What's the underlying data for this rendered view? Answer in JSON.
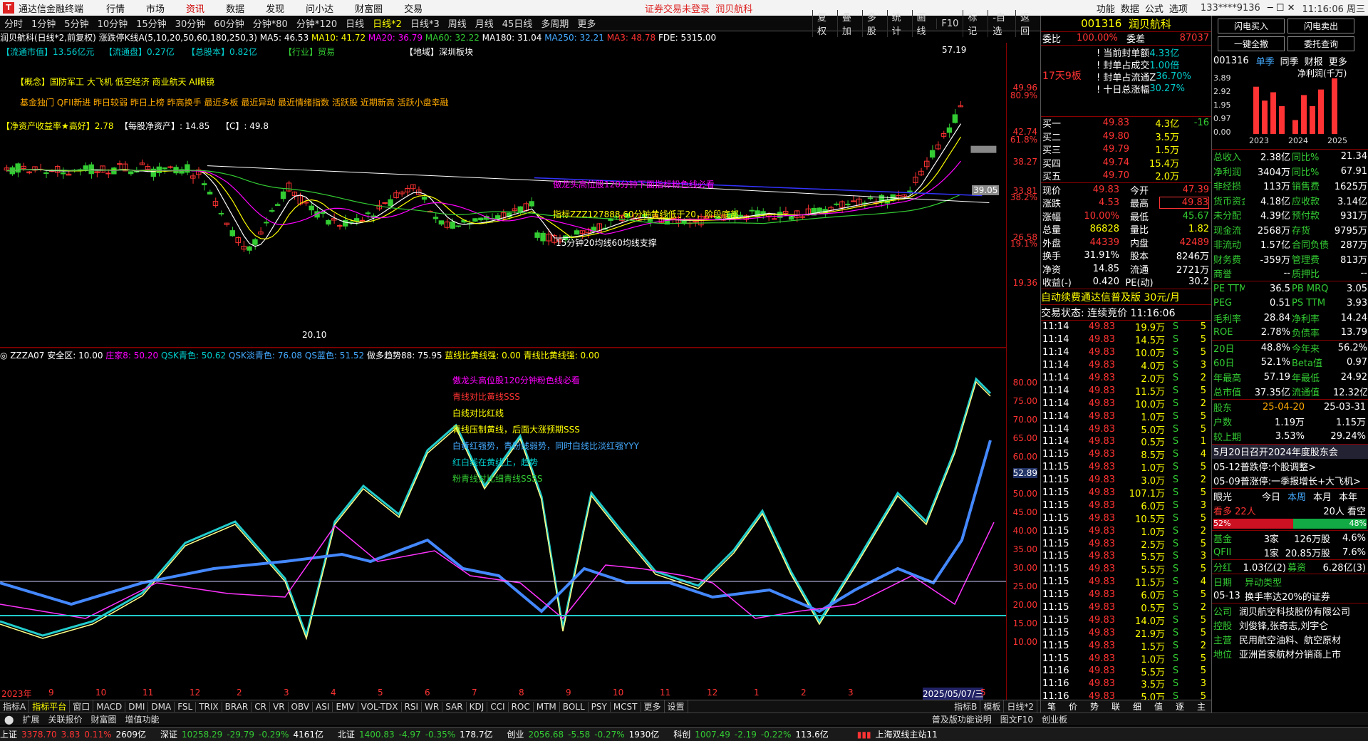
{
  "app": {
    "title": "通达信金融终端",
    "menu": [
      "行情",
      "市场",
      "资讯",
      "数据",
      "发现",
      "问小达",
      "财富圈",
      "交易"
    ],
    "menu_active": "资讯",
    "notice": "证券交易未登录",
    "notice2": "润贝航科",
    "right_menu": [
      "功能",
      "数据",
      "公式",
      "选项"
    ],
    "account": "133****9136",
    "clock": "11:16:06 周三"
  },
  "periods": [
    "分时",
    "1分钟",
    "5分钟",
    "10分钟",
    "15分钟",
    "30分钟",
    "60分钟",
    "分钟*80",
    "分钟*120",
    "日线",
    "日线*2",
    "日线*3",
    "周线",
    "月线",
    "45日线",
    "多周期",
    "更多"
  ],
  "period_active": "日线*2",
  "toolbar2": [
    "复权",
    "叠加",
    "多股",
    "统计",
    "画线",
    "F10",
    "标记",
    "-自选",
    "返回"
  ],
  "infoline": {
    "name": "润贝航科(日线*2,前复权)",
    "ind": "涨跌停K线A(5,10,20,50,60,180,250,3)",
    "ma5": "MA5: 46.53",
    "ma10": "MA10: 41.72",
    "ma20": "MA20: 36.79",
    "ma60": "MA60: 32.22",
    "ma180": "MA180: 31.04",
    "ma250": "MA250: 32.21",
    "ma3": "MA3: 48.78",
    "fde": "FDE: 5315.00"
  },
  "tags": {
    "ltsz": "【流通市值】13.56亿元",
    "ltp": "【流通盘】0.27亿",
    "zgb": "【总股本】0.82亿",
    "hy": "【行业】贸易",
    "dy": "【地域】深圳板块",
    "gn": "【概念】国防军工 大飞机 低空经济 商业航天 AI眼镜",
    "fg": "基金独门 QFII新进 昨日较弱 昨日上榜 昨高换手 最近多板 最近异动 最近情绪指数 活跃股 近期新高 活跃小盘幸融",
    "roe": "【净资产收益率★高好】2.78",
    "mgjzc": "【每股净资产】: 14.85",
    "c": "【C】: 49.8",
    "ann1": "傲龙头高位股120分钟下面指标粉色线必看",
    "ann2": "指标ZZZ127888,60分钟黄线低于20，阶段底部",
    "ann3": "15分钟20均线60均线支撑",
    "high": "57.19",
    "low": "20.10",
    "cur_tag": "39.05"
  },
  "axis1": [
    "49.96",
    "80.9%",
    "42.74",
    "61.8%",
    "38.27",
    "33.81",
    "38.2%",
    "26.58",
    "19.1%",
    "19.36"
  ],
  "ind": {
    "head": "ZZZA07",
    "items": [
      "安全区: 10.00",
      "庄家8: 50.20",
      "QSK青色: 50.62",
      "QSK淡青色: 76.08",
      "QS蓝色: 51.52",
      "做多趋势88: 75.95",
      "蓝线比黄线强: 0.00",
      "青线比黄线强: 0.00"
    ],
    "text": [
      "傲龙头高位股120分钟粉色线必看",
      "青线对比黄线SSS",
      "白线对比红线",
      "青线压制黄线，后面大涨预期SSS",
      "白黄红强势，青粉线弱势，同时白线比淡红强YYY",
      "红白线在黄线上，趋势",
      "粉青线对比细青线SSSS"
    ],
    "axis": [
      "80.00",
      "75.00",
      "70.00",
      "65.00",
      "60.00",
      "55.00",
      "52.89",
      "50.00",
      "45.00",
      "40.00",
      "35.00",
      "30.00",
      "25.00",
      "20.00",
      "15.00",
      "10.00"
    ]
  },
  "dates": [
    "2023年",
    "9",
    "10",
    "11",
    "12",
    "2",
    "3",
    "4",
    "5",
    "6",
    "7",
    "8",
    "9",
    "10",
    "11",
    "12",
    "1",
    "2",
    "3",
    "2025/05/07/三",
    "5"
  ],
  "bottomtabs": [
    "指标A",
    "指标平台",
    "窗口",
    "MACD",
    "DMI",
    "DMA",
    "FSL",
    "TRIX",
    "BRAR",
    "CR",
    "VR",
    "OBV",
    "ASI",
    "EMV",
    "VOL-TDX",
    "RSI",
    "WR",
    "SAR",
    "KDJ",
    "CCI",
    "ROC",
    "MTM",
    "BOLL",
    "PSY",
    "MCST",
    "更多",
    "设置"
  ],
  "bottomtabs_right": [
    "指标B",
    "模板",
    "日线*2"
  ],
  "bottomtabs2": [
    "扩展",
    "关联报价",
    "财富圈",
    "增值功能"
  ],
  "bottomtabs2_right": [
    "普及版功能说明",
    "图文F10",
    "创业板"
  ],
  "status": {
    "sh": "上证",
    "sh_v": "3378.70",
    "sh_c": "3.83",
    "sh_p": "0.11%",
    "sh_a": "2609亿",
    "sz": "深证",
    "sz_v": "10258.29",
    "sz_c": "-29.79",
    "sz_p": "-0.29%",
    "sz_a": "4161亿",
    "bz": "北证",
    "bz_v": "1400.83",
    "bz_c": "-4.97",
    "bz_p": "-0.35%",
    "bz_a": "178.7亿",
    "cy": "创业",
    "cy_v": "2056.68",
    "cy_c": "-5.58",
    "cy_p": "-0.27%",
    "cy_a": "1930亿",
    "kc": "科创",
    "kc_v": "1007.49",
    "kc_c": "-2.19",
    "kc_p": "-0.22%",
    "kc_a": "113.6亿",
    "server": "上海双线主站11"
  },
  "quote": {
    "code": "001316",
    "name": "润贝航科",
    "wb_label": "委比",
    "wb": "100.00%",
    "wc_label": "委差",
    "wc": "87037",
    "seal": [
      [
        "当前封单额",
        "4.33亿"
      ],
      [
        "封单占成交",
        "1.00倍"
      ],
      [
        "封单占流通Z",
        "36.70%"
      ],
      [
        "十日总涨幅",
        "30.27%"
      ]
    ],
    "board": "17天9板",
    "buy": [
      [
        "买一",
        "49.83",
        "4.3亿",
        "-16"
      ],
      [
        "买二",
        "49.80",
        "3.5万",
        ""
      ],
      [
        "买三",
        "49.79",
        "1.5万",
        ""
      ],
      [
        "买四",
        "49.74",
        "15.4万",
        ""
      ],
      [
        "买五",
        "49.70",
        "2.0万",
        ""
      ]
    ],
    "stats": [
      [
        "现价",
        "49.83",
        "今开",
        "47.39"
      ],
      [
        "涨跌",
        "4.53",
        "最高",
        "49.83"
      ],
      [
        "涨幅",
        "10.00%",
        "最低",
        "45.67"
      ],
      [
        "总量",
        "86828",
        "量比",
        "1.82"
      ],
      [
        "外盘",
        "44339",
        "内盘",
        "42489"
      ],
      [
        "换手",
        "31.91%",
        "股本",
        "8246万"
      ],
      [
        "净资",
        "14.85",
        "流通",
        "2721万"
      ],
      [
        "收益(-)",
        "0.420",
        "PE(动)",
        "30.2"
      ]
    ],
    "ad": "自动续费通达信普及版  30元/月",
    "trade_state": "交易状态: 连续竞价 11:16:06",
    "ticks": [
      [
        "11:14",
        "49.83",
        "19.9万",
        "S",
        "5"
      ],
      [
        "11:14",
        "49.83",
        "14.5万",
        "S",
        "5"
      ],
      [
        "11:14",
        "49.83",
        "10.0万",
        "S",
        "5"
      ],
      [
        "11:14",
        "49.83",
        "4.0万",
        "S",
        "3"
      ],
      [
        "11:14",
        "49.83",
        "2.0万",
        "S",
        "2"
      ],
      [
        "11:14",
        "49.83",
        "11.5万",
        "S",
        "5"
      ],
      [
        "11:14",
        "49.83",
        "10.0万",
        "S",
        "2"
      ],
      [
        "11:14",
        "49.83",
        "1.0万",
        "S",
        "5"
      ],
      [
        "11:14",
        "49.83",
        "5.0万",
        "S",
        "5"
      ],
      [
        "11:14",
        "49.83",
        "0.5万",
        "S",
        "1"
      ],
      [
        "11:15",
        "49.83",
        "8.5万",
        "S",
        "4"
      ],
      [
        "11:15",
        "49.83",
        "1.0万",
        "S",
        "5"
      ],
      [
        "11:15",
        "49.83",
        "3.0万",
        "S",
        "2"
      ],
      [
        "11:15",
        "49.83",
        "107.1万",
        "S",
        "5"
      ],
      [
        "11:15",
        "49.83",
        "6.0万",
        "S",
        "3"
      ],
      [
        "11:15",
        "49.83",
        "10.5万",
        "S",
        "5"
      ],
      [
        "11:15",
        "49.83",
        "1.0万",
        "S",
        "2"
      ],
      [
        "11:15",
        "49.83",
        "2.5万",
        "S",
        "5"
      ],
      [
        "11:15",
        "49.83",
        "5.5万",
        "S",
        "3"
      ],
      [
        "11:15",
        "49.83",
        "5.5万",
        "S",
        "5"
      ],
      [
        "11:15",
        "49.83",
        "11.5万",
        "S",
        "4"
      ],
      [
        "11:15",
        "49.83",
        "6.0万",
        "S",
        "5"
      ],
      [
        "11:15",
        "49.83",
        "0.5万",
        "S",
        "2"
      ],
      [
        "11:15",
        "49.83",
        "14.0万",
        "S",
        "5"
      ],
      [
        "11:15",
        "49.83",
        "21.9万",
        "S",
        "5"
      ],
      [
        "11:15",
        "49.83",
        "1.5万",
        "S",
        "2"
      ],
      [
        "11:15",
        "49.83",
        "1.0万",
        "S",
        "5"
      ],
      [
        "11:16",
        "49.83",
        "5.5万",
        "S",
        "5"
      ],
      [
        "11:16",
        "49.83",
        "3.5万",
        "S",
        "3"
      ],
      [
        "11:16",
        "49.83",
        "5.0万",
        "S",
        "5"
      ]
    ],
    "foot": [
      "笔",
      "价",
      "势",
      "联",
      "细",
      "值",
      "逐",
      "主"
    ]
  },
  "side": {
    "btns": [
      "闪电买入",
      "闪电卖出",
      "一键全撤",
      "委托查询"
    ],
    "code": "001316",
    "tabs": [
      "单季",
      "同季",
      "财报",
      "更多"
    ],
    "chart_label": "净利润(千万)",
    "ylabels": [
      "3.89",
      "2.92",
      "1.95",
      "0.97",
      "0.00"
    ],
    "years": [
      "2023",
      "2024",
      "2025"
    ],
    "fin": [
      [
        "总收入",
        "2.38亿",
        "同比%",
        "21.34"
      ],
      [
        "净利润",
        "3404万",
        "同比%",
        "67.91"
      ],
      [
        "非经损",
        "113万",
        "销售费",
        "1625万"
      ],
      [
        "货币资金",
        "4.18亿",
        "应收款",
        "3.14亿"
      ],
      [
        "未分配",
        "4.39亿",
        "预付款",
        "931万"
      ],
      [
        "现金流",
        "2568万",
        "存货",
        "9795万"
      ],
      [
        "非流动",
        "1.57亿",
        "合同负债",
        "287万"
      ],
      [
        "财务费",
        "-359万",
        "管理费",
        "813万"
      ],
      [
        "商誉",
        "--",
        "质押比",
        "--"
      ]
    ],
    "val": [
      [
        "PE TTM",
        "36.5",
        "PB MRQ",
        "3.05"
      ],
      [
        "PEG",
        "0.51",
        "PS TTM",
        "3.93"
      ],
      [
        "毛利率",
        "28.84",
        "净利率",
        "14.24"
      ],
      [
        "ROE",
        "2.78%",
        "负债率",
        "13.79"
      ]
    ],
    "perf": [
      [
        "20日",
        "48.8%",
        "今年来",
        "56.2%"
      ],
      [
        "60日",
        "52.1%",
        "Beta值",
        "0.97"
      ],
      [
        "年最高",
        "57.19",
        "年最低",
        "24.92"
      ],
      [
        "总市值",
        "37.35亿",
        "流通值",
        "12.32亿"
      ]
    ],
    "holders": [
      [
        "股东",
        "25-04-20",
        "25-03-31"
      ],
      [
        "户数",
        "1.19万",
        "1.15万"
      ],
      [
        "较上期",
        "3.53%",
        "29.24%"
      ]
    ],
    "news": [
      "5月20日召开2024年度股东会",
      "05-12普跌停:个股调整>",
      "05-09普涨停:一季报增长+大飞机>"
    ],
    "eye": {
      "label": "眼光",
      "tabs": [
        "今日",
        "本周",
        "本月",
        "本年"
      ],
      "bull": "看多 22人",
      "bear": "20人 看空",
      "bull_p": "52%",
      "bear_p": "48%"
    },
    "inst": [
      [
        "基金",
        "3家",
        "126万股",
        "4.6%"
      ],
      [
        "QFII",
        "1家",
        "20.85万股",
        "7.6%"
      ]
    ],
    "fh": [
      "分红",
      "1.03亿(2)",
      "募资",
      "6.28亿(3)"
    ],
    "event": [
      [
        "日期",
        "异动类型"
      ],
      [
        "05-13",
        "换手率达20%的证券"
      ]
    ],
    "company": [
      [
        "公司",
        "润贝航空科技股份有限公司"
      ],
      [
        "控股",
        "刘俊锋,张奇志,刘宇仑"
      ],
      [
        "主营",
        "民用航空油料、航空原材"
      ],
      [
        "地位",
        "亚洲首家航材分销商上市"
      ]
    ]
  }
}
